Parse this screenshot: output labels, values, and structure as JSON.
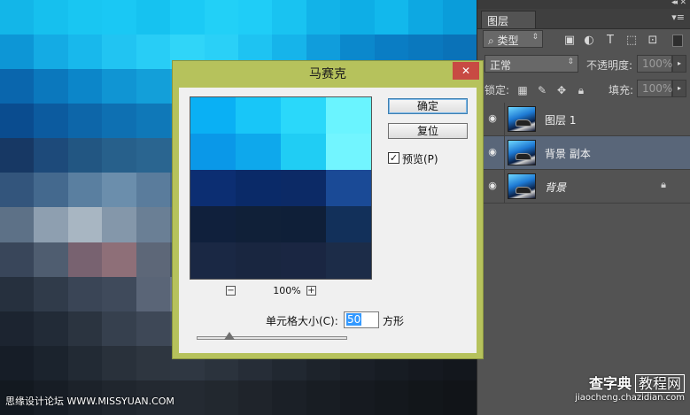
{
  "canvas": {
    "tiles": [
      "#13b6e8",
      "#16c0ee",
      "#19c6f2",
      "#1ac8f4",
      "#16c2f0",
      "#1bcaf5",
      "#22d0f7",
      "#1fcdf7",
      "#19c3f1",
      "#12b3e8",
      "#0eaee6",
      "#12b8ec",
      "#0da8e2",
      "#0a9dda",
      "#0d96d6",
      "#14abe4",
      "#18b8ec",
      "#21c4f2",
      "#28cdf6",
      "#30d5f8",
      "#2ad0f7",
      "#1ec3f2",
      "#16b4ea",
      "#109ddc",
      "#0b88cc",
      "#0a7dc4",
      "#0a78be",
      "#0a72b8",
      "#0a66ad",
      "#0b78bd",
      "#0c86c9",
      "#1095d3",
      "#139fd9",
      "#15a6dd",
      "#14a3dc",
      "#1198d6",
      "#0d8acb",
      "#0b7abd",
      "#096bb0",
      "#095ea3",
      "#08579c",
      "#085296",
      "#0a4c8f",
      "#0c5b9f",
      "#0d66a9",
      "#0e70b2",
      "#0f78b8",
      "#107dbb",
      "#1079b8",
      "#0e6fb0",
      "#0c63a5",
      "#0a5899",
      "#084d8e",
      "#074585",
      "#073f7e",
      "#063a78",
      "#173864",
      "#1d4a7a",
      "#225682",
      "#27608b",
      "#2a6590",
      "#296590",
      "#265f8a",
      "#215783",
      "#1c4d7b",
      "#184373",
      "#143a6a",
      "#113262",
      "#0f2c5b",
      "#0e2855",
      "#33557c",
      "#44698e",
      "#5a7fa0",
      "#6b8eac",
      "#5a7c9c",
      "#486a8c",
      "#3d5e80",
      "#365677",
      "#2f4e6f",
      "#294766",
      "#233f5e",
      "#1e3856",
      "#1b334f",
      "#182e48",
      "#5d7187",
      "#8e9fb0",
      "#a8b6c2",
      "#8497aa",
      "#6a7f95",
      "#5a6e84",
      "#4d6177",
      "#42566c",
      "#394c62",
      "#31435a",
      "#2a3b52",
      "#24344a",
      "#1f2e43",
      "#1b293c",
      "#39465a",
      "#4f5d70",
      "#786270",
      "#8e6f78",
      "#5d6778",
      "#4a5768",
      "#3e4b5c",
      "#354152",
      "#2e3a4a",
      "#283343",
      "#232d3c",
      "#1f2836",
      "#1b2330",
      "#171f2b",
      "#26303e",
      "#303b4a",
      "#3a4556",
      "#3f4a5b",
      "#5a6577",
      "#6e7a8b",
      "#58637a",
      "#3e4656",
      "#2f3746",
      "#283040",
      "#222a38",
      "#1d2430",
      "#19202a",
      "#161c25",
      "#1c2430",
      "#222b37",
      "#2b3440",
      "#36404e",
      "#3e4857",
      "#434d5c",
      "#3b4453",
      "#323a48",
      "#2a323f",
      "#242b37",
      "#1f2530",
      "#1b212a",
      "#181d25",
      "#151a21",
      "#161d27",
      "#1b232d",
      "#222a34",
      "#29313b",
      "#2e3640",
      "#2f3742",
      "#2b333d",
      "#262d37",
      "#212831",
      "#1d232b",
      "#1a1f27",
      "#171c23",
      "#151920",
      "#13171d",
      "#131920",
      "#171d25",
      "#1c222a",
      "#20262e",
      "#232931",
      "#242a32",
      "#22282f",
      "#1f242b",
      "#1b2027",
      "#181d23",
      "#161a20",
      "#14181d",
      "#12161a",
      "#111418"
    ],
    "watermark": "思缘设计论坛 WWW.MISSYUAN.COM"
  },
  "panel": {
    "tab_label": "图层",
    "filter_type": "类型",
    "blend_mode": "正常",
    "opacity_label": "不透明度:",
    "opacity_value": "100%",
    "lock_label": "锁定:",
    "fill_label": "填充:",
    "fill_value": "100%",
    "layers": [
      {
        "name": "图层 1",
        "selected": false,
        "italic": false,
        "locked": false
      },
      {
        "name": "背景 副本",
        "selected": true,
        "italic": false,
        "locked": false
      },
      {
        "name": "背景",
        "selected": false,
        "italic": true,
        "locked": true
      }
    ],
    "watermark_main": "查字典",
    "watermark_box": "教程网",
    "watermark_sub": "jiaocheng.chazidian.com"
  },
  "dialog": {
    "title": "马赛克",
    "ok_label": "确定",
    "reset_label": "复位",
    "preview_label": "预览(P)",
    "preview_checked": true,
    "zoom_minus": "−",
    "zoom_plus": "+",
    "zoom_value": "100%",
    "cell_size_label": "单元格大小(C):",
    "cell_size_value": "50",
    "unit_label": "方形",
    "slider_fraction": 0.22,
    "preview_cells": [
      "#0ab0f4",
      "#18c6f8",
      "#2ad8fa",
      "#6af4ff",
      "#0a98e8",
      "#0ea8ec",
      "#20cdf4",
      "#72f5ff",
      "#0c2e72",
      "#0a2a68",
      "#0c2a66",
      "#1a4a96",
      "#10203c",
      "#102038",
      "#0f1f38",
      "#12305a",
      "#1a2844",
      "#192640",
      "#1a2642",
      "#1c2c48"
    ]
  }
}
